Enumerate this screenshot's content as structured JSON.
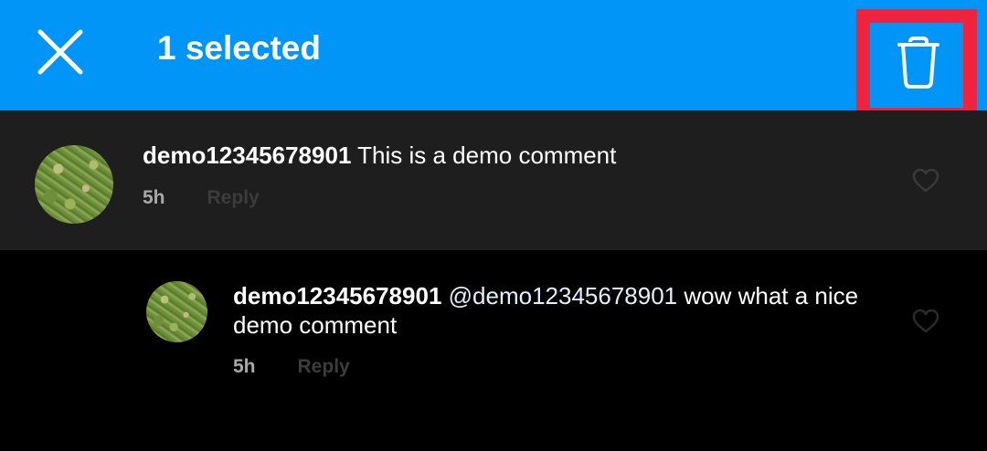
{
  "header": {
    "title": "1 selected",
    "close_icon": "close-icon",
    "delete_icon": "trash-icon",
    "background_color": "#0095f6",
    "highlight_color": "#f0233f"
  },
  "comments": [
    {
      "username": "demo12345678901",
      "text": " This is a demo comment",
      "time": "5h",
      "reply_label": "Reply",
      "avatar_icon": "grass-avatar",
      "like_icon": "heart-icon",
      "selected": true
    },
    {
      "username": "demo12345678901",
      "mention": "@demo12345678901",
      "text": " wow what a nice demo comment",
      "time": "5h",
      "reply_label": "Reply",
      "avatar_icon": "grass-avatar",
      "like_icon": "heart-icon",
      "selected": false
    }
  ]
}
